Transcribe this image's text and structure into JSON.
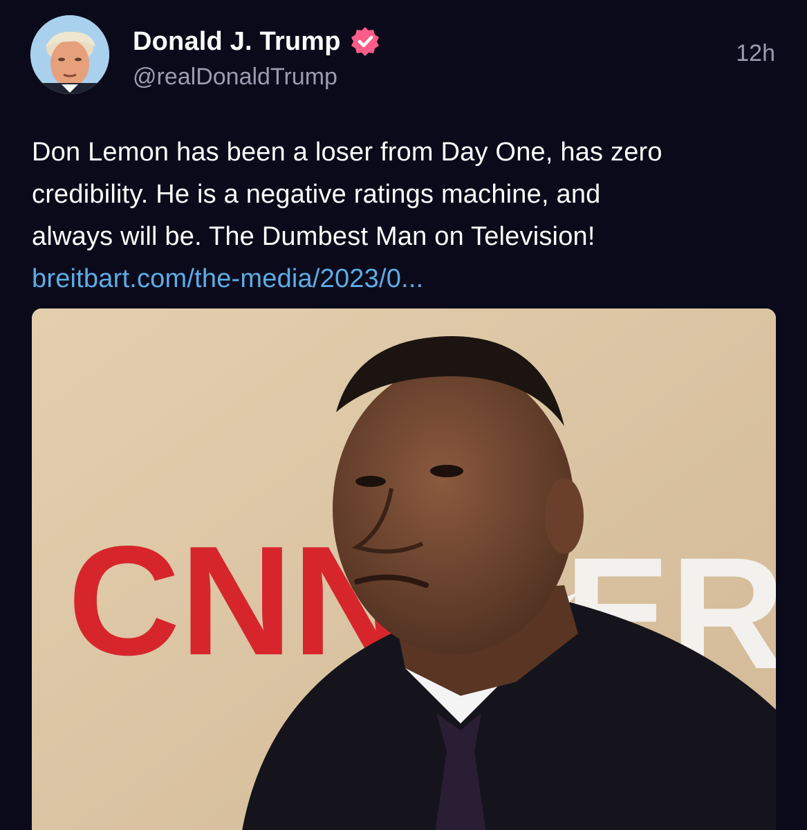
{
  "post": {
    "author": {
      "display_name": "Donald J. Trump",
      "handle": "@realDonaldTrump",
      "verified": true,
      "avatar_icon": "user-avatar"
    },
    "timestamp": "12h",
    "lines": [
      "Don Lemon has been a loser from Day One, has zero",
      "credibility. He is a negative ratings machine, and",
      "always will be. The Dumbest Man on Television!"
    ],
    "link_text": "breitbart.com/the-media/2023/0...",
    "media": {
      "backdrop_logo": "CNN",
      "backdrop_partial": "ER"
    }
  },
  "colors": {
    "background": "#0b0a1b",
    "text": "#ffffff",
    "muted": "#9c9bb0",
    "link": "#5aaee8",
    "verified_badge": "#ff5c8a",
    "cnn_red": "#d6262c"
  }
}
